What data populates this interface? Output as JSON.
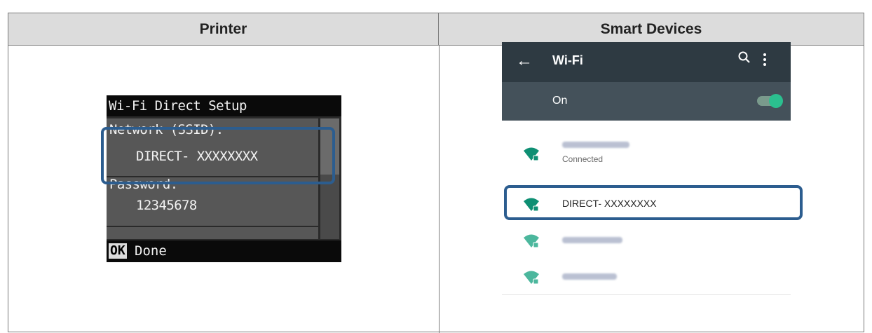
{
  "table": {
    "col_left": "Printer",
    "col_right": "Smart Devices"
  },
  "printer": {
    "screen_title": "Wi-Fi Direct Setup",
    "network_label": "Network (SSID):",
    "network_value": "DIRECT- XXXXXXXX",
    "password_label": "Password:",
    "password_value": "12345678",
    "ok_label": "OK",
    "done_label": "Done"
  },
  "phone": {
    "title": "Wi-Fi",
    "toggle_label": "On",
    "networks": [
      {
        "name": "",
        "blurred": true,
        "status": "Connected",
        "icon": "wifi-locked-icon"
      },
      {
        "name": "DIRECT- XXXXXXXX",
        "blurred": false,
        "status": "",
        "icon": "wifi-locked-icon"
      },
      {
        "name": "",
        "blurred": true,
        "status": "",
        "icon": "wifi-locked-icon"
      },
      {
        "name": "",
        "blurred": true,
        "status": "",
        "icon": "wifi-locked-icon"
      }
    ]
  },
  "colors": {
    "highlight": "#2c5d8f",
    "accent_wifi": "#0e8f73",
    "appbar": "#2e3a42",
    "onbar": "#44515a"
  }
}
